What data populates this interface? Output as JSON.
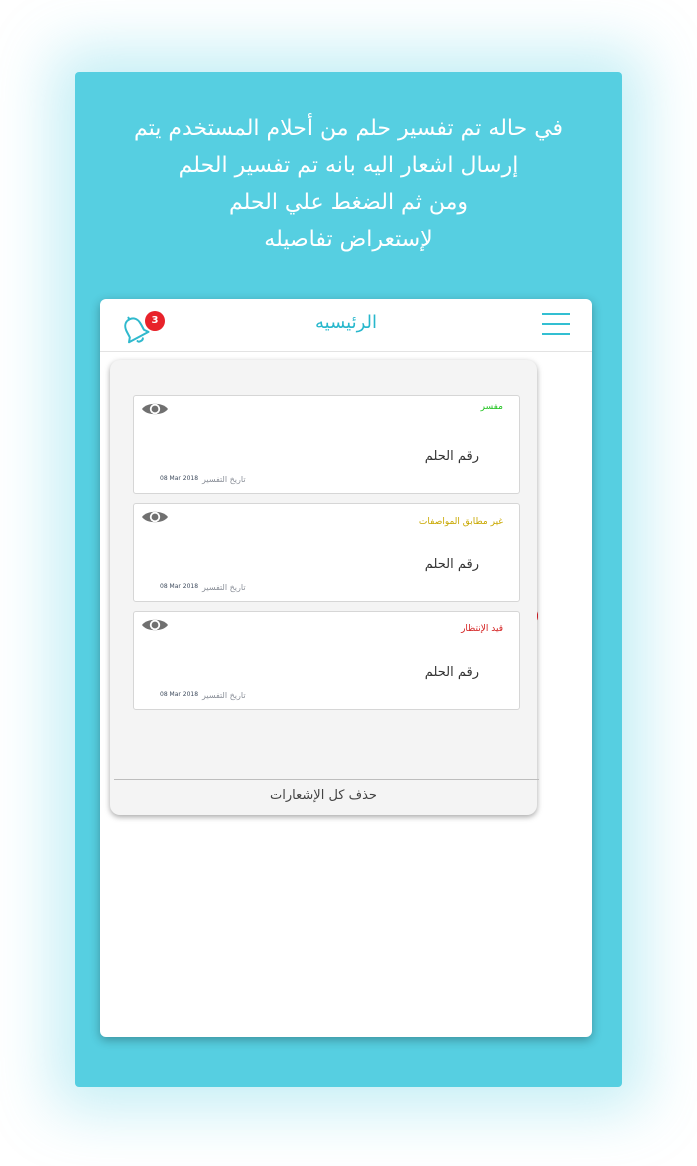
{
  "caption": {
    "lines": [
      "في حاله تم تفسير حلم من أحلام المستخدم  يتم",
      "إرسال اشعار اليه بانه تم تفسير الحلم",
      "ومن ثم الضغط علي الحلم",
      "لإستعراض تفاصيله"
    ]
  },
  "appbar": {
    "title": "الرئيسيه",
    "notification_count": "3",
    "menu_icon": "hamburger-icon",
    "bell_icon": "bell-icon"
  },
  "notifications": [
    {
      "status": "مفسر",
      "status_color": "#22c422",
      "dream_number": "رقم الحلم",
      "date_label": "تاريخ التفسير",
      "date": "08 Mar 2018"
    },
    {
      "status": "غير مطابق المواصفات",
      "status_color": "#c9a800",
      "dream_number": "رقم الحلم",
      "date_label": "تاريخ التفسير",
      "date": "08 Mar 2018"
    },
    {
      "status": "قيد الإنتظار",
      "status_color": "#d42020",
      "dream_number": "رقم الحلم",
      "date_label": "تاريخ التفسير",
      "date": "08 Mar 2018"
    }
  ],
  "clear_all_label": "حذف كل الإشعارات",
  "colors": {
    "panel": "#56cfe1",
    "accent": "#27b7cc",
    "badge": "#e8222a"
  }
}
